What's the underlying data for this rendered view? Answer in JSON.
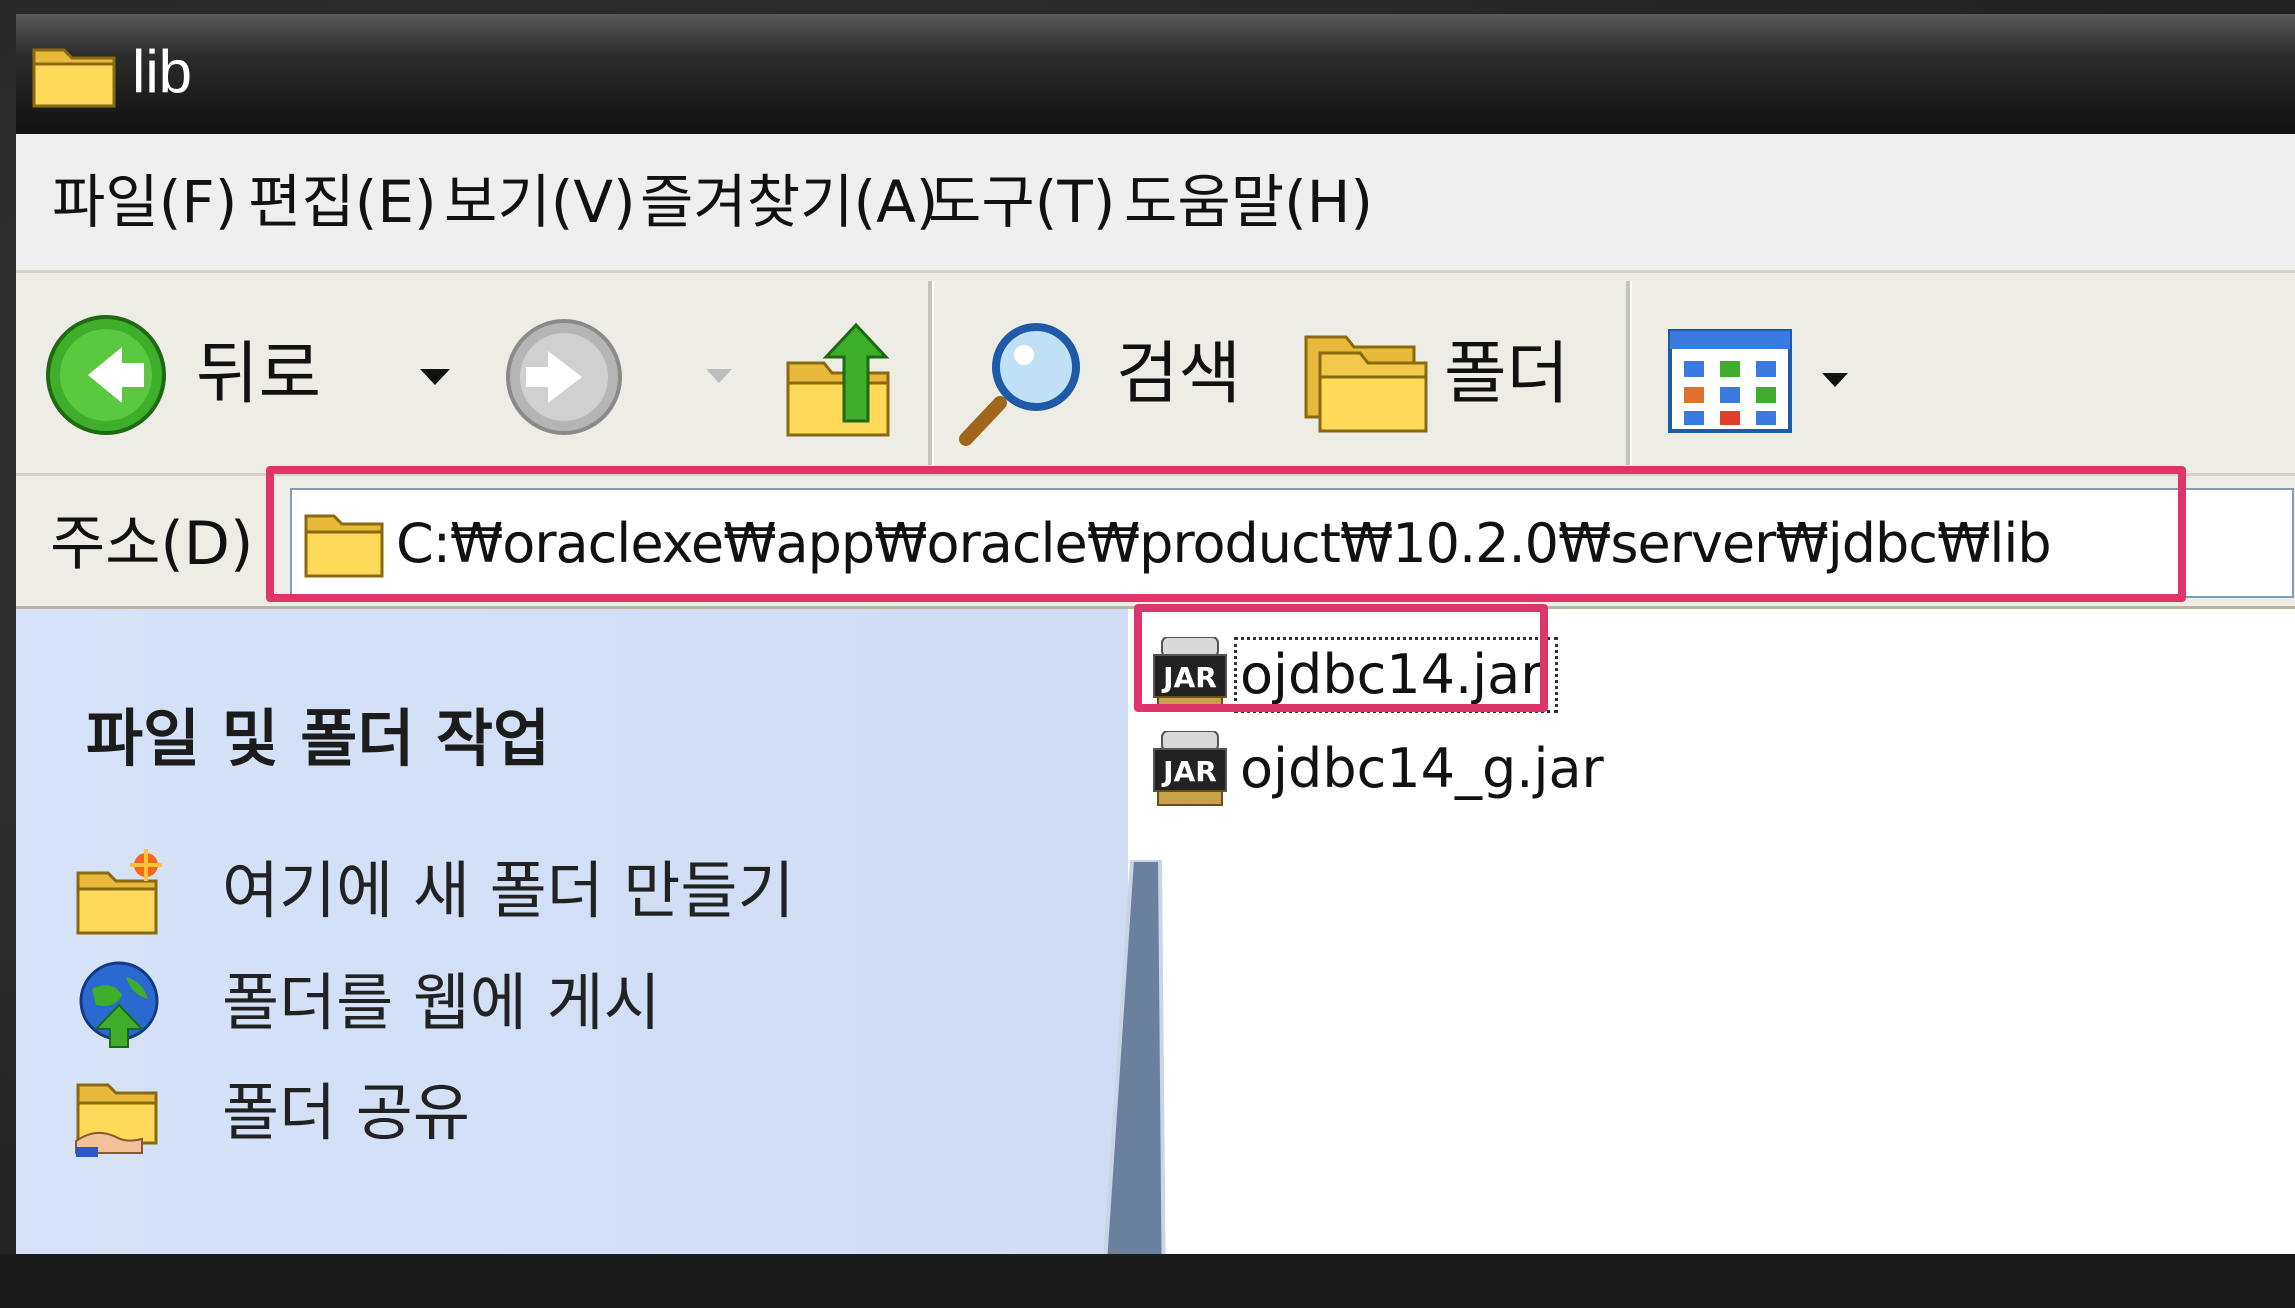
{
  "window": {
    "title": "lib",
    "title_icon": "folder-icon"
  },
  "menu": {
    "items": [
      "파일(F)",
      "편집(E)",
      "보기(V)",
      "즐겨찾기(A)",
      "도구(T)",
      "도움말(H)"
    ]
  },
  "toolbar": {
    "back_label": "뒤로",
    "search_label": "검색",
    "folders_label": "폴더",
    "icons": [
      "back-arrow-icon",
      "dropdown-arrow-icon",
      "forward-arrow-icon",
      "up-folder-icon",
      "search-magnifier-icon",
      "folders-icon",
      "views-icon"
    ]
  },
  "address": {
    "label": "주소(D)",
    "path": "C:₩oraclexe₩app₩oracle₩product₩10.2.0₩server₩jdbc₩lib"
  },
  "task_pane": {
    "title": "파일 및 폴더 작업",
    "items": [
      {
        "label": "여기에 새 폴더 만들기",
        "icon": "new-folder-icon"
      },
      {
        "label": "폴더를 웹에 게시",
        "icon": "publish-web-icon"
      },
      {
        "label": "폴더 공유",
        "icon": "share-folder-icon"
      }
    ]
  },
  "files": [
    {
      "name": "ojdbc14.jar",
      "icon": "jar-file-icon",
      "selected": true
    },
    {
      "name": "ojdbc14_g.jar",
      "icon": "jar-file-icon",
      "selected": false
    }
  ],
  "colors": {
    "highlight": "#e0356a",
    "task_pane_bg": "#d6e2f7",
    "title_bar": "#111111"
  }
}
